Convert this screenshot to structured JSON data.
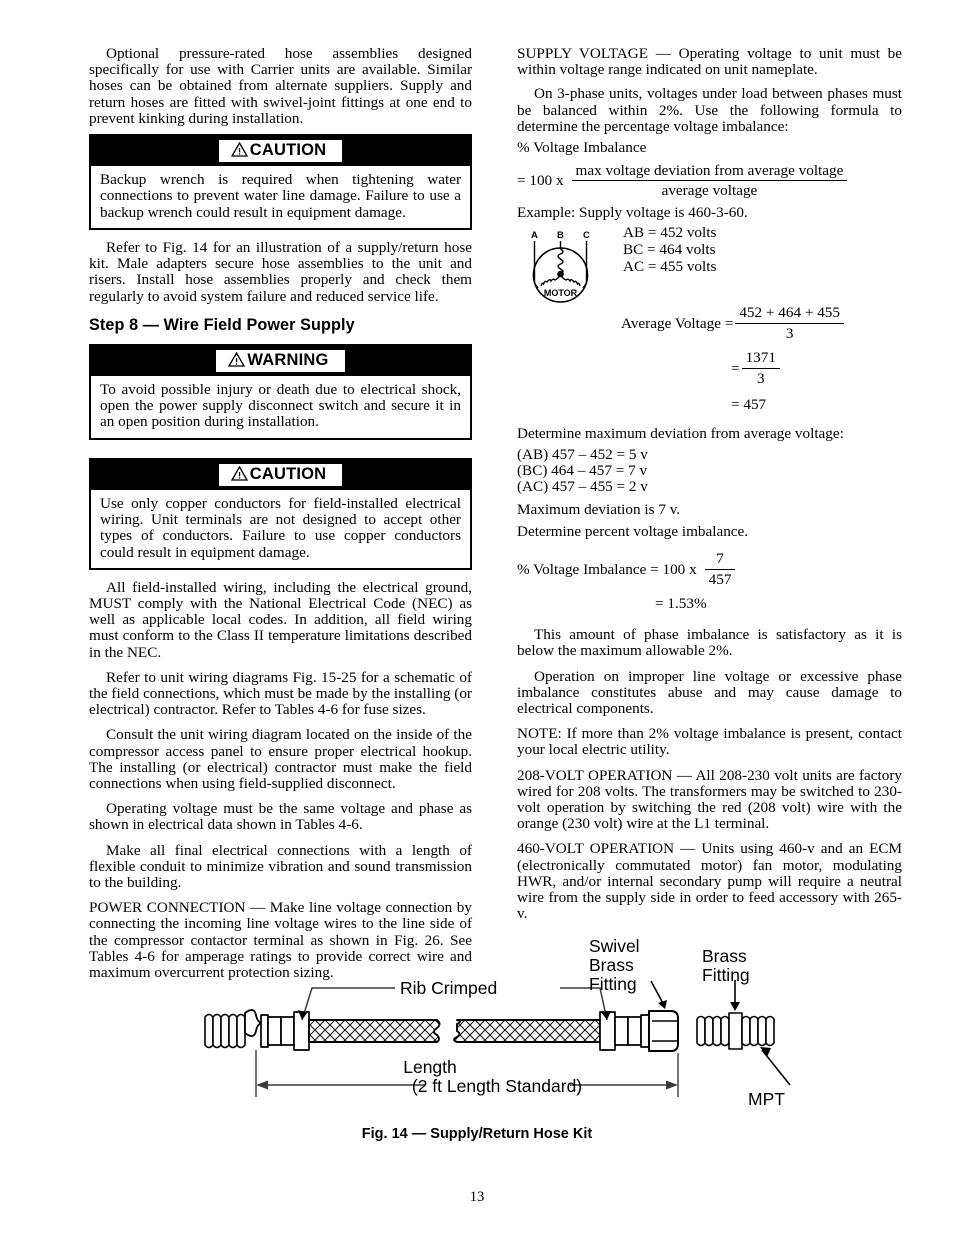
{
  "document": {
    "page_number": "13",
    "figure_caption": "Fig. 14 — Supply/Return Hose Kit"
  },
  "left_column": {
    "para_hose_assemblies": "Optional pressure-rated hose assemblies designed specifically for use with Carrier units are available. Similar hoses can be obtained from alternate suppliers. Supply and return hoses are fitted with swivel-joint fittings at one end to prevent kinking during installation.",
    "caution_1": {
      "label": "CAUTION",
      "text": "Backup wrench is required when tightening water connections to prevent water line damage. Failure to use a backup wrench could result in equipment damage."
    },
    "para_refer_fig14": "Refer to Fig. 14 for an illustration of a supply/return hose kit. Male adapters secure hose assemblies to the unit and risers. Install hose assemblies properly and check them regularly to avoid system failure and reduced service life.",
    "heading_step8": "Step 8 — Wire Field Power Supply",
    "warning_1": {
      "label": "WARNING",
      "text": "To avoid possible injury or death due to electrical shock, open the power supply disconnect switch and secure it in an open position during installation."
    },
    "caution_2": {
      "label": "CAUTION",
      "text": "Use only copper conductors for field-installed electrical wiring. Unit terminals are not designed to accept other types of conductors. Failure to use copper conductors could result in equipment damage."
    },
    "para_nec": "All field-installed wiring, including the electrical ground, MUST comply with the National Electrical Code (NEC) as well as applicable local codes. In addition, all field wiring must conform to the Class II temperature limitations described in the NEC.",
    "para_wiring_diagrams": "Refer to unit wiring diagrams Fig. 15-25 for a schematic of the field connections, which must be made by the installing (or electrical) contractor. Refer to Tables 4-6 for fuse sizes.",
    "para_consult": "Consult the unit wiring diagram located on the inside of the compressor access panel to ensure proper electrical hookup. The installing (or electrical) contractor must make the field connections when using field-supplied disconnect.",
    "para_operating_voltage": "Operating voltage must be the same voltage and phase as shown in electrical data shown in Tables 4-6.",
    "para_flexible_conduit": "Make all final electrical connections with a length of flexible conduit to minimize vibration and sound transmission to the building.",
    "para_power_connection": "POWER CONNECTION  — Make line voltage connection by connecting the incoming line voltage wires to the line side of the compressor contactor terminal as shown in Fig. 26. See Tables 4-6 for amperage ratings to provide correct wire and maximum overcurrent protection sizing."
  },
  "right_column": {
    "para_supply_voltage": "SUPPLY VOLTAGE — Operating voltage to unit must be within voltage range indicated on unit nameplate.",
    "para_three_phase": "On 3-phase units, voltages under load between phases must be balanced within 2%. Use the following formula to determine the percentage voltage imbalance:",
    "label_pct_imbalance": "% Voltage Imbalance",
    "formula": {
      "lead": "= 100 x",
      "numerator": "max voltage deviation from average voltage",
      "denominator": "average voltage"
    },
    "example_line": "Example: Supply voltage is 460-3-60.",
    "motor_diagram": {
      "phase_a": "A",
      "phase_b": "B",
      "phase_c": "C",
      "label": "MOTOR"
    },
    "measurements": [
      "AB = 452 volts",
      "BC = 464 volts",
      "AC = 455 volts"
    ],
    "average": {
      "label": "Average Voltage =",
      "numerator": "452 + 464 + 455",
      "denominator": "3",
      "equals2": "=",
      "numerator2": "1371",
      "denominator2": "3",
      "result": "=   457"
    },
    "para_determine_max": "Determine maximum deviation from average voltage:",
    "deviations": [
      "(AB) 457 – 452 = 5 v",
      "(BC) 464 – 457 = 7 v",
      "(AC) 457 – 455 = 2 v"
    ],
    "para_max_deviation": "Maximum deviation is 7 v.",
    "para_determine_percent": "Determine percent voltage imbalance.",
    "imbalance": {
      "lead": "% Voltage Imbalance = 100 x",
      "numerator": "7",
      "denominator": "457",
      "result": "=  1.53%"
    },
    "para_satisfactory": "This amount of phase imbalance is satisfactory as it is below the maximum allowable 2%.",
    "para_improper": "Operation on improper line voltage or excessive phase imbalance constitutes abuse and may cause damage to electrical components.",
    "para_note": "NOTE: If more than 2% voltage imbalance is present, contact your local electric utility.",
    "para_208": "208-VOLT OPERATION — All 208-230 volt units are factory wired for 208 volts. The transformers may be switched to 230-volt operation by switching the red (208 volt) wire with the orange (230 volt) wire at the L1 terminal.",
    "para_460": "460-VOLT OPERATION — Units using 460-v and an ECM (electronically commutated motor) fan motor, modulating HWR, and/or internal secondary pump will require a neutral wire from the supply side in order to feed accessory with 265-v."
  },
  "figure": {
    "callouts": {
      "rib_crimped": "Rib Crimped",
      "swivel_brass_fitting_line1": "Swivel",
      "swivel_brass_fitting_line2": "Brass",
      "swivel_brass_fitting_line3": "Fitting",
      "brass_fitting_line1": "Brass",
      "brass_fitting_line2": "Fitting",
      "mpt": "MPT",
      "length": "Length",
      "length_standard": "(2 ft  Length Standard)"
    }
  }
}
